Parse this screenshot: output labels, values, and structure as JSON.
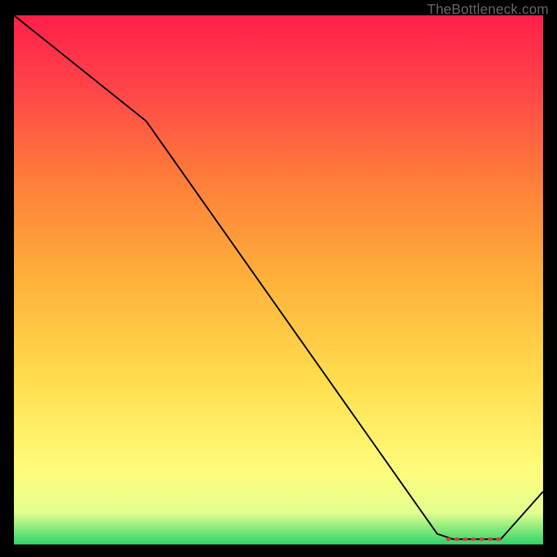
{
  "watermark": "TheBottleneck.com",
  "chart_data": {
    "type": "line",
    "title": "",
    "xlabel": "",
    "ylabel": "",
    "xlim": [
      0,
      100
    ],
    "ylim": [
      0,
      100
    ],
    "gradient_stops": [
      {
        "offset": 0,
        "color": "#2fd36a"
      },
      {
        "offset": 6,
        "color": "#e2ff8f"
      },
      {
        "offset": 14,
        "color": "#fffc7d"
      },
      {
        "offset": 30,
        "color": "#ffdf4e"
      },
      {
        "offset": 50,
        "color": "#ffb13b"
      },
      {
        "offset": 70,
        "color": "#ff7a3a"
      },
      {
        "offset": 85,
        "color": "#ff4848"
      },
      {
        "offset": 100,
        "color": "#ff1f4a"
      }
    ],
    "series": [
      {
        "name": "bottleneck-curve",
        "x": [
          0,
          25,
          80,
          83,
          92,
          100
        ],
        "y": [
          100,
          80,
          2,
          1,
          1,
          10
        ]
      }
    ],
    "markers": {
      "name": "optimal-range",
      "x": [
        82,
        84,
        86,
        88,
        90,
        92
      ],
      "y": [
        1,
        1,
        1,
        1,
        1,
        1
      ]
    }
  }
}
